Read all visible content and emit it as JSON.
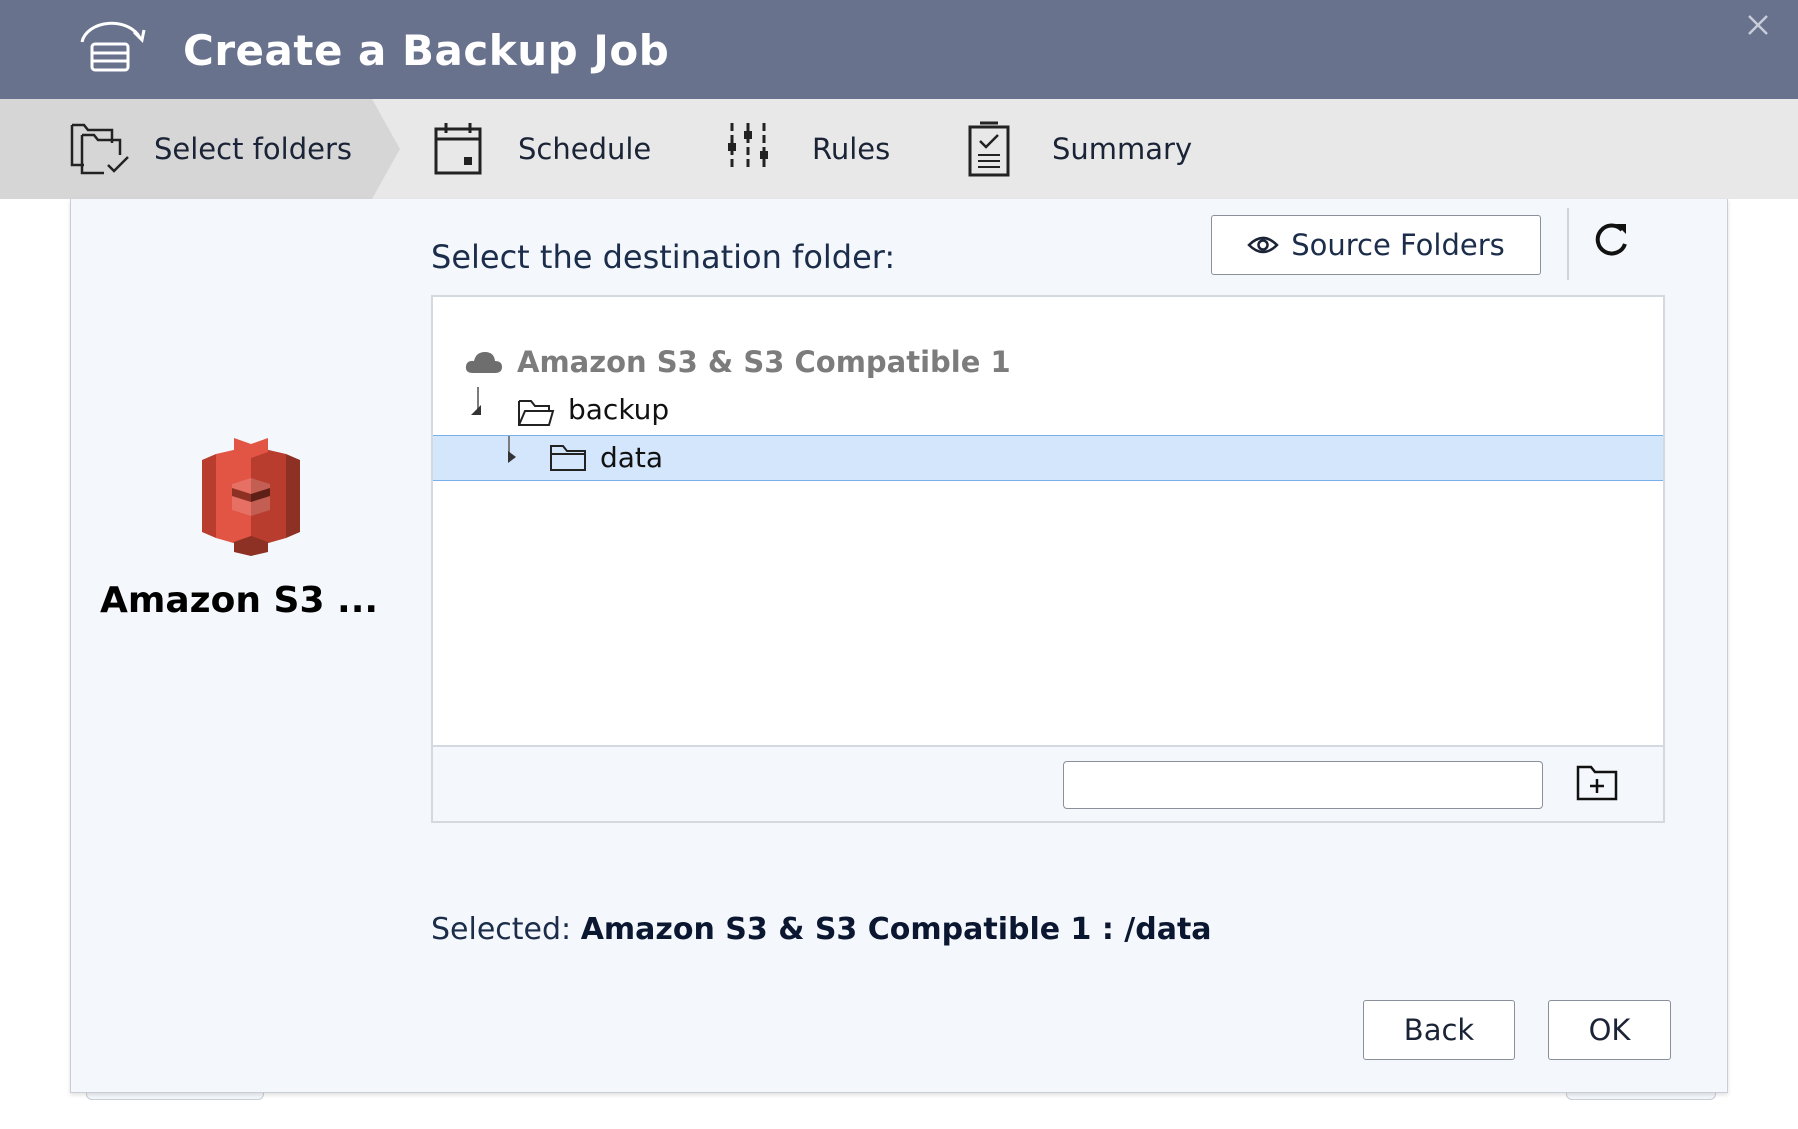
{
  "window": {
    "title": "Create a Backup Job",
    "title_icon": "backup-job-icon",
    "close_icon": "close-icon"
  },
  "steps": [
    {
      "label": "Select folders",
      "icon": "select-folders-icon",
      "active": true
    },
    {
      "label": "Schedule",
      "icon": "calendar-icon",
      "active": false
    },
    {
      "label": "Rules",
      "icon": "sliders-icon",
      "active": false
    },
    {
      "label": "Summary",
      "icon": "clipboard-check-icon",
      "active": false
    }
  ],
  "provider": {
    "name": "Amazon S3 ...",
    "logo": "amazon-s3-logo"
  },
  "destination": {
    "label": "Select the destination folder:",
    "source_folders_label": "Source Folders",
    "refresh_icon": "refresh-icon"
  },
  "tree": {
    "root": {
      "label": "Amazon S3 & S3 Compatible 1",
      "icon": "cloud-icon"
    },
    "nodes": [
      {
        "label": "backup",
        "icon": "folder-open-icon",
        "expanded": true,
        "level": 1,
        "selected": false
      },
      {
        "label": "data",
        "icon": "folder-icon",
        "expanded": false,
        "level": 2,
        "selected": true
      }
    ],
    "new_folder": {
      "value": "",
      "placeholder": "",
      "button_icon": "new-folder-icon"
    }
  },
  "selection": {
    "prefix": "Selected:",
    "value": "Amazon S3 & S3 Compatible 1 : /data"
  },
  "actions": {
    "back_label": "Back",
    "ok_label": "OK"
  },
  "colors": {
    "titlebar": "#68728d",
    "steps_bg": "#e8e8e8",
    "active_step_bg": "#d6d6d6",
    "selected_row": "#d4e6fb",
    "s3_brand": "#e25444"
  }
}
